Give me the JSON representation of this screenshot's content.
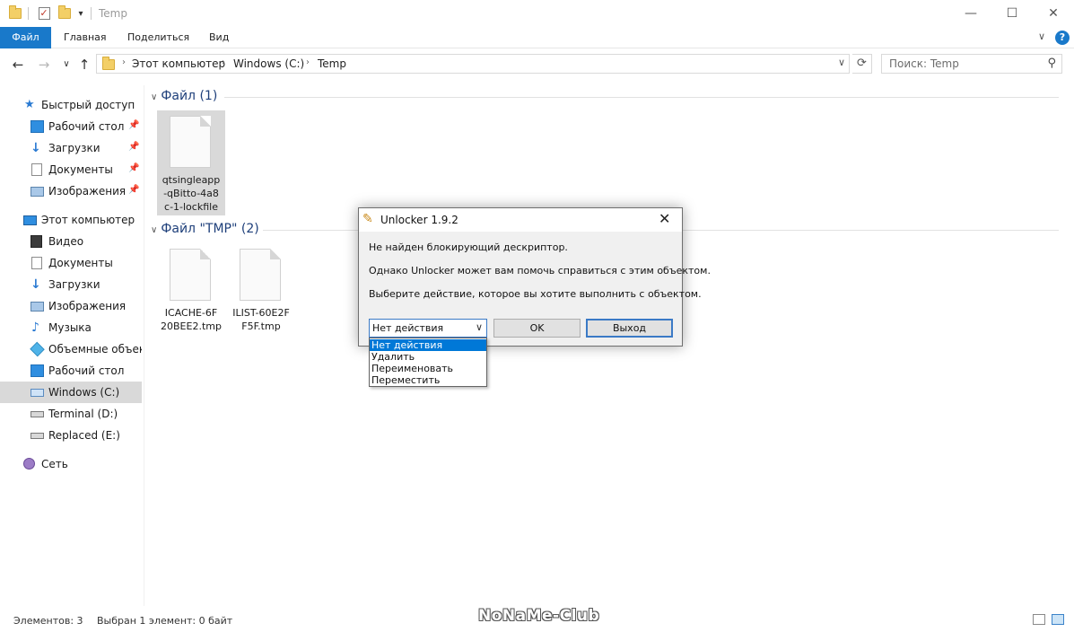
{
  "window": {
    "title": "Temp",
    "controls": [
      "minimize-icon",
      "maximize-icon",
      "close-icon"
    ]
  },
  "ribbon": {
    "tabs": [
      "Файл",
      "Главная",
      "Поделиться",
      "Вид"
    ],
    "accent": "#1979ca"
  },
  "address": {
    "crumbs": [
      "Этот компьютер",
      "Windows (C:)",
      "Temp"
    ],
    "search_placeholder": "Поиск: Temp"
  },
  "nav": {
    "quick_access": "Быстрый доступ",
    "quick_items": [
      "Рабочий стол",
      "Загрузки",
      "Документы",
      "Изображения"
    ],
    "this_pc": "Этот компьютер",
    "pc_items": [
      "Видео",
      "Документы",
      "Загрузки",
      "Изображения",
      "Музыка",
      "Объемные объекты",
      "Рабочий стол",
      "Windows (C:)",
      "Terminal (D:)",
      "Replaced (E:)"
    ],
    "selected": "Windows (C:)",
    "network": "Сеть"
  },
  "groups": [
    {
      "header": "Файл (1)",
      "files": [
        {
          "name_lines": [
            "qtsingleapp",
            "-qBitto-4a8",
            "c-1-lockfile"
          ],
          "selected": true
        }
      ]
    },
    {
      "header": "Файл \"TMP\" (2)",
      "files": [
        {
          "name_lines": [
            "ICACHE-6F",
            "20BEE2.tmp"
          ],
          "selected": false
        },
        {
          "name_lines": [
            "ILIST-60E2F",
            "F5F.tmp"
          ],
          "selected": false
        }
      ]
    }
  ],
  "status": {
    "count": "Элементов: 3",
    "selection": "Выбран 1 элемент: 0 байт",
    "watermark": "NoNaMe-Club"
  },
  "dialog": {
    "title": "Unlocker 1.9.2",
    "messages": [
      "Не найден блокирующий дескриптор.",
      "Однако Unlocker может вам помочь справиться с этим объектом.",
      "Выберите действие, которое вы хотите выполнить с объектом."
    ],
    "action_selected": "Нет действия",
    "action_options": [
      "Нет действия",
      "Удалить",
      "Переименовать",
      "Переместить"
    ],
    "ok_label": "OK",
    "exit_label": "Выход",
    "highlight_color": "#0078d7"
  }
}
